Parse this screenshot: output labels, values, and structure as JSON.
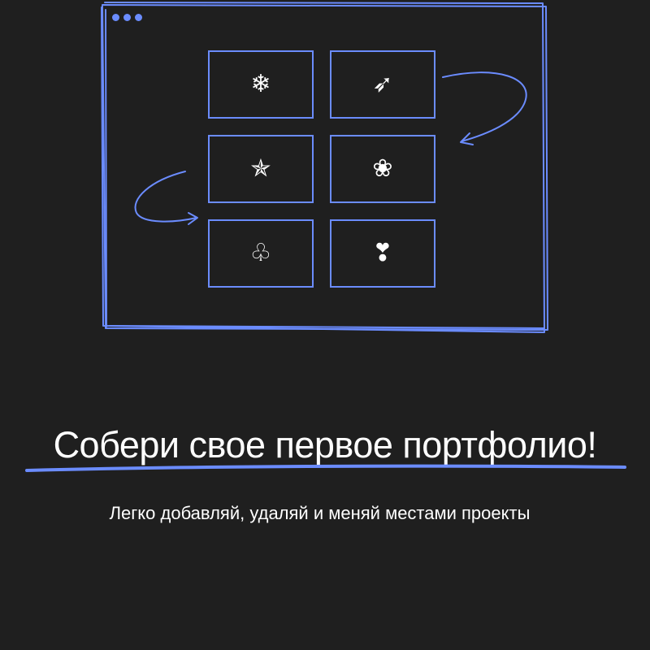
{
  "window": {
    "control_dots": [
      "dot",
      "dot",
      "dot"
    ]
  },
  "grid": {
    "tiles": [
      {
        "icon": "snowflake-icon",
        "glyph": "❄"
      },
      {
        "icon": "arrow-icon",
        "glyph": "➶"
      },
      {
        "icon": "star-icon",
        "glyph": "✯"
      },
      {
        "icon": "flower-icon",
        "glyph": "❀"
      },
      {
        "icon": "club-icon",
        "glyph": "♧"
      },
      {
        "icon": "heart-icon",
        "glyph": "❣"
      }
    ]
  },
  "headline": "Собери свое первое портфолио!",
  "subtitle": "Легко добавляй, удаляй и меняй местами проекты",
  "colors": {
    "background": "#1f1f1f",
    "accent": "#6b8cff",
    "text": "#ffffff"
  }
}
